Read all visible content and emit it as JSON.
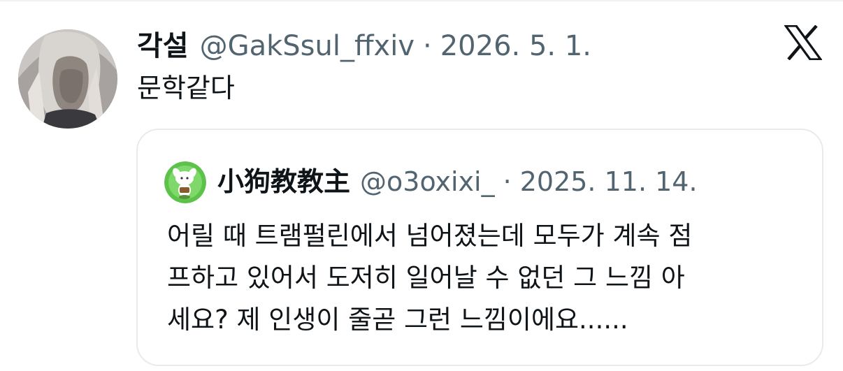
{
  "tweet": {
    "author_name": "각설",
    "handle": "@GakSsul_ffxiv",
    "separator": "·",
    "date": "2026. 5. 1.",
    "text": "문학같다",
    "avatar_icon": "profile-avatar",
    "platform_icon": "x-logo-icon"
  },
  "quoted_tweet": {
    "author_name": "小狗教教主",
    "handle": "@o3oxixi_",
    "separator": "·",
    "date": "2025. 11. 14.",
    "avatar_icon": "profile-avatar",
    "text_lines": [
      "어릴 때 트램펄린에서 넘어졌는데 모두가 계속 점",
      "프하고 있어서 도저히 일어날 수 없던 그 느낌 아",
      "세요? 제 인생이 줄곧 그런 느낌이에요......"
    ]
  },
  "colors": {
    "text_primary": "#0f1419",
    "text_secondary": "#536471",
    "border": "#e6ebee",
    "background": "#ffffff"
  }
}
